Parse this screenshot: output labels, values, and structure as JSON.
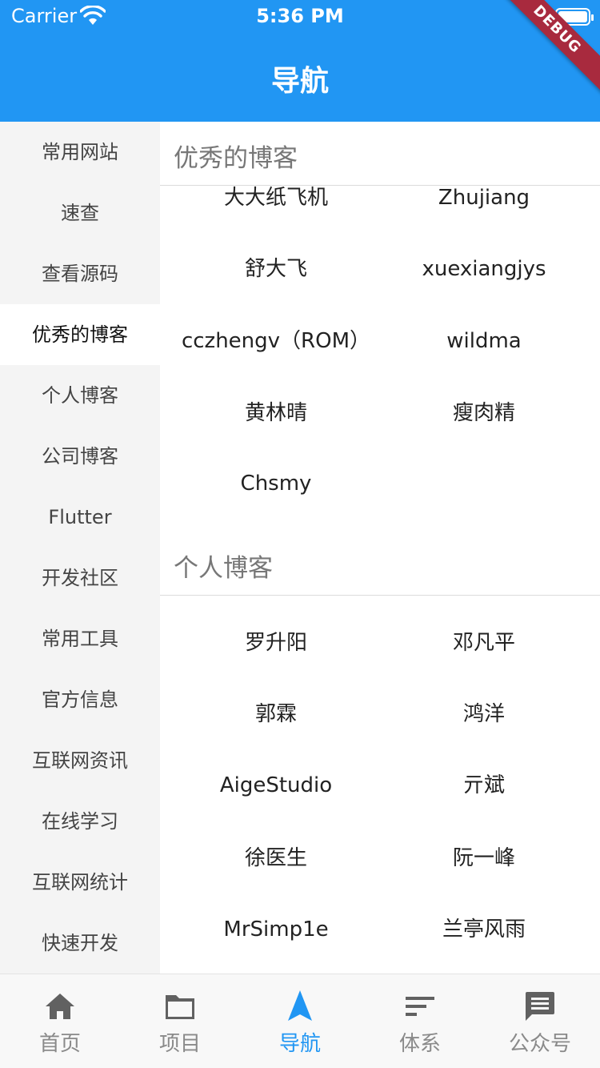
{
  "status_bar": {
    "carrier": "Carrier",
    "time": "5:36 PM"
  },
  "app_bar": {
    "title": "导航",
    "debug_banner": "DEBUG",
    "color": "#2196f3"
  },
  "sidebar": {
    "active_index": 3,
    "items": [
      {
        "label": "常用网站"
      },
      {
        "label": "速查"
      },
      {
        "label": "查看源码"
      },
      {
        "label": "优秀的博客"
      },
      {
        "label": "个人博客"
      },
      {
        "label": "公司博客"
      },
      {
        "label": "Flutter"
      },
      {
        "label": "开发社区"
      },
      {
        "label": "常用工具"
      },
      {
        "label": "官方信息"
      },
      {
        "label": "互联网资讯"
      },
      {
        "label": "在线学习"
      },
      {
        "label": "互联网统计"
      },
      {
        "label": "快速开发"
      }
    ]
  },
  "sections": [
    {
      "title": "优秀的博客",
      "items": [
        "大大纸飞机",
        "Zhujiang",
        "舒大飞",
        "xuexiangjys",
        "cczhengv（ROM）",
        "wildma",
        "黄林晴",
        "瘦肉精",
        "Chsmy"
      ]
    },
    {
      "title": "个人博客",
      "items": [
        "罗升阳",
        "邓凡平",
        "郭霖",
        "鸿洋",
        "AigeStudio",
        "亓斌",
        "徐医生",
        "阮一峰",
        "MrSimp1e",
        "兰亭风雨"
      ]
    }
  ],
  "bottom_nav": {
    "active_index": 2,
    "active_color": "#2196f3",
    "inactive_color": "#8a8a8a",
    "items": [
      {
        "label": "首页",
        "icon": "home-icon"
      },
      {
        "label": "项目",
        "icon": "folder-icon"
      },
      {
        "label": "导航",
        "icon": "navigation-arrow-icon"
      },
      {
        "label": "体系",
        "icon": "sort-lines-icon"
      },
      {
        "label": "公众号",
        "icon": "chat-message-icon"
      }
    ]
  }
}
